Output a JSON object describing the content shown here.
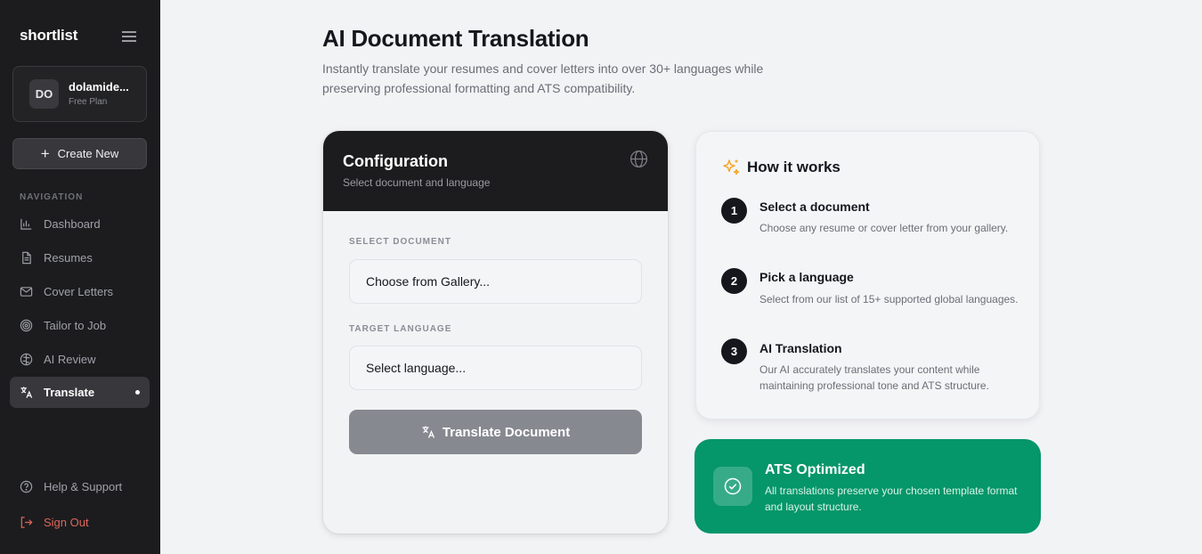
{
  "sidebar": {
    "logo": "shortlist",
    "user": {
      "initials": "DO",
      "name": "dolamide...",
      "plan": "Free Plan"
    },
    "create_label": "Create New",
    "nav_heading": "NAVIGATION",
    "items": [
      {
        "label": "Dashboard",
        "icon": "bar-chart-icon"
      },
      {
        "label": "Resumes",
        "icon": "document-icon"
      },
      {
        "label": "Cover Letters",
        "icon": "mail-icon"
      },
      {
        "label": "Tailor to Job",
        "icon": "target-icon"
      },
      {
        "label": "AI Review",
        "icon": "brain-icon"
      },
      {
        "label": "Translate",
        "icon": "translate-icon",
        "active": true
      }
    ],
    "help_label": "Help & Support",
    "signout_label": "Sign Out"
  },
  "main": {
    "title": "AI Document Translation",
    "description": "Instantly translate your resumes and cover letters into over 30+ languages while preserving professional formatting and ATS compatibility."
  },
  "config": {
    "title": "Configuration",
    "subtitle": "Select document and language",
    "document_label": "SELECT DOCUMENT",
    "document_value": "Choose from Gallery...",
    "language_label": "TARGET LANGUAGE",
    "language_value": "Select language...",
    "button_label": "Translate Document"
  },
  "how_it_works": {
    "title": "How it works",
    "steps": [
      {
        "number": "1",
        "title": "Select a document",
        "description": "Choose any resume or cover letter from your gallery."
      },
      {
        "number": "2",
        "title": "Pick a language",
        "description": "Select from our list of 15+ supported global languages."
      },
      {
        "number": "3",
        "title": "AI Translation",
        "description": "Our AI accurately translates your content while maintaining professional tone and ATS structure."
      }
    ]
  },
  "ats": {
    "title": "ATS Optimized",
    "description": "All translations preserve your chosen template format and layout structure."
  },
  "colors": {
    "sidebar_bg": "#1c1c1e",
    "accent_green": "#059669",
    "sign_out_red": "#e0655a",
    "sparkle_yellow": "#f5a524"
  }
}
